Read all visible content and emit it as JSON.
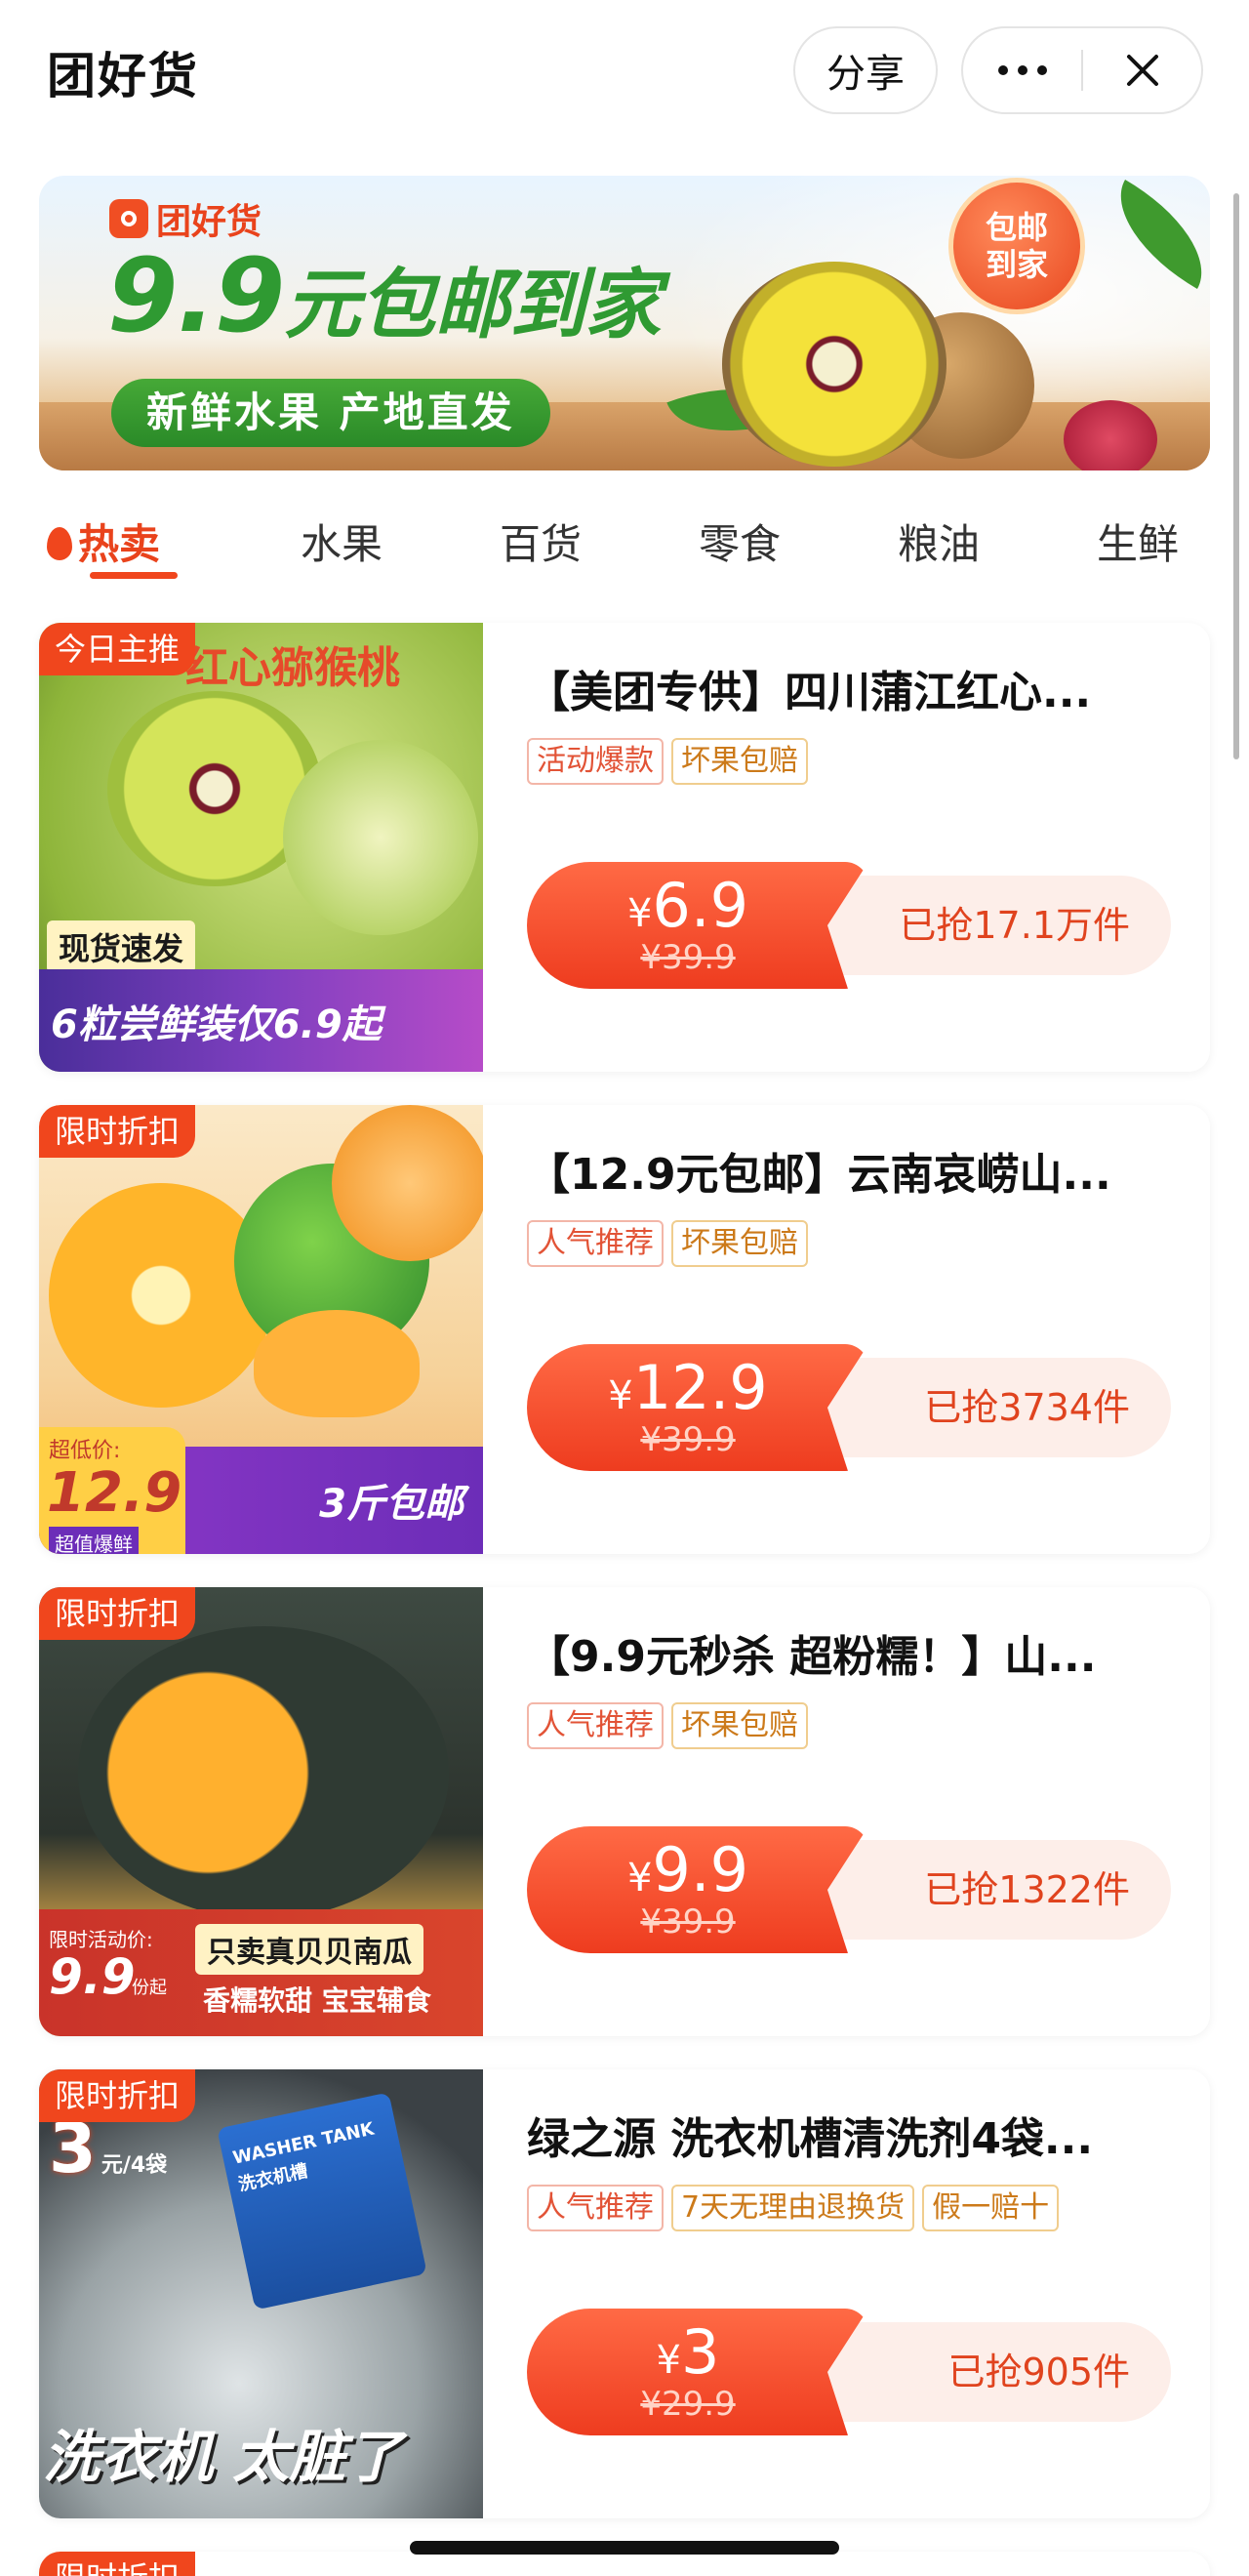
{
  "header": {
    "title": "团好货",
    "share_label": "分享",
    "more_icon": "more-dots-icon",
    "close_icon": "close-icon"
  },
  "banner": {
    "brand": "团好货",
    "headline_big": "9.9",
    "headline_rest": "元包邮到家",
    "sub": "新鲜水果 产地直发",
    "badge_line1": "包邮",
    "badge_line2": "到家"
  },
  "tabs": [
    {
      "label": "热卖",
      "active": true
    },
    {
      "label": "水果",
      "active": false
    },
    {
      "label": "百货",
      "active": false
    },
    {
      "label": "零食",
      "active": false
    },
    {
      "label": "粮油",
      "active": false
    },
    {
      "label": "生鲜",
      "active": false
    }
  ],
  "products": [
    {
      "corner_tag": "今日主推",
      "thumb_top": "红心猕猴桃",
      "thumb_chip": "现货速发",
      "thumb_band": "6粒尝鲜装仅6.9起",
      "title": "【美团专供】四川蒲江红心...",
      "tags": [
        "活动爆款",
        "坏果包赔"
      ],
      "price": "6.9",
      "old_price": "¥39.9",
      "sold": "已抢17.1万件"
    },
    {
      "corner_tag": "限时折扣",
      "thumb_price_label": "超低价:",
      "thumb_price": "12.9",
      "thumb_price_sub": "超值爆鲜",
      "thumb_band": "3斤包邮",
      "title": "【12.9元包邮】云南哀崂山...",
      "tags": [
        "人气推荐",
        "坏果包赔"
      ],
      "price": "12.9",
      "old_price": "¥39.9",
      "sold": "已抢3734件"
    },
    {
      "corner_tag": "限时折扣",
      "thumb_price_label": "限时活动价:",
      "thumb_price": "9.9",
      "thumb_price_unit": "份起",
      "thumb_line1": "只卖真贝贝南瓜",
      "thumb_line2": "香糯软甜 宝宝辅食",
      "title": "【9.9元秒杀 超粉糯！】山...",
      "tags": [
        "人气推荐",
        "坏果包赔"
      ],
      "price": "9.9",
      "old_price": "¥39.9",
      "sold": "已抢1322件"
    },
    {
      "corner_tag": "限时折扣",
      "thumb_price": "3",
      "thumb_price_unit": "元/4袋",
      "thumb_pack": "WASHER TANK 洗衣机槽",
      "thumb_band": "洗衣机 太脏了",
      "title": "绿之源 洗衣机槽清洗剂4袋...",
      "tags": [
        "人气推荐",
        "7天无理由退换货",
        "假一赔十"
      ],
      "price": "3",
      "old_price": "¥29.9",
      "sold": "已抢905件"
    }
  ],
  "next_card_tag": "限时折扣",
  "colors": {
    "accent": "#f0461d",
    "green": "#2f9a32",
    "price_bg": "#ee3c1f",
    "sold_bg": "#fdeee9"
  }
}
